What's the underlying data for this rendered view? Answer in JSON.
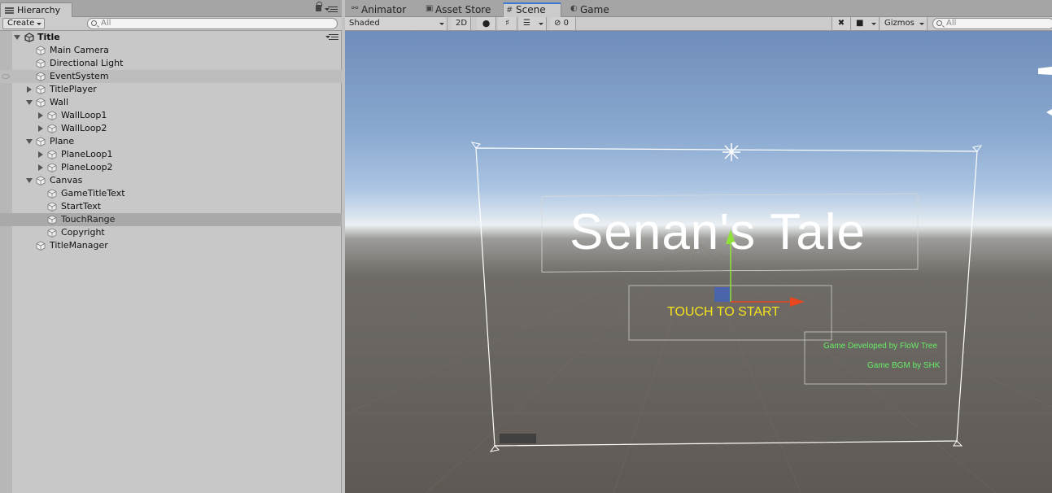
{
  "hierarchy": {
    "tab_label": "Hierarchy",
    "create_label": "Create",
    "search_placeholder": "All",
    "scene_name": "Title",
    "items": [
      {
        "label": "Main Camera",
        "depth": 1,
        "expand": "none",
        "state": ""
      },
      {
        "label": "Directional Light",
        "depth": 1,
        "expand": "none",
        "state": ""
      },
      {
        "label": "EventSystem",
        "depth": 1,
        "expand": "none",
        "state": "hover"
      },
      {
        "label": "TitlePlayer",
        "depth": 1,
        "expand": "collapsed",
        "state": ""
      },
      {
        "label": "Wall",
        "depth": 1,
        "expand": "expanded",
        "state": ""
      },
      {
        "label": "WallLoop1",
        "depth": 2,
        "expand": "collapsed",
        "state": ""
      },
      {
        "label": "WallLoop2",
        "depth": 2,
        "expand": "collapsed",
        "state": ""
      },
      {
        "label": "Plane",
        "depth": 1,
        "expand": "expanded",
        "state": ""
      },
      {
        "label": "PlaneLoop1",
        "depth": 2,
        "expand": "collapsed",
        "state": ""
      },
      {
        "label": "PlaneLoop2",
        "depth": 2,
        "expand": "collapsed",
        "state": ""
      },
      {
        "label": "Canvas",
        "depth": 1,
        "expand": "expanded",
        "state": ""
      },
      {
        "label": "GameTitleText",
        "depth": 2,
        "expand": "none",
        "state": ""
      },
      {
        "label": "StartText",
        "depth": 2,
        "expand": "none",
        "state": ""
      },
      {
        "label": "TouchRange",
        "depth": 2,
        "expand": "none",
        "state": "selected"
      },
      {
        "label": "Copyright",
        "depth": 2,
        "expand": "none",
        "state": ""
      },
      {
        "label": "TitleManager",
        "depth": 1,
        "expand": "none",
        "state": ""
      }
    ]
  },
  "tabs": {
    "animator": "Animator",
    "asset_store": "Asset Store",
    "scene": "Scene",
    "game": "Game"
  },
  "scene_toolbar": {
    "shading_mode": "Shaded",
    "mode_2d": "2D",
    "hidden_count": "0",
    "gizmos": "Gizmos",
    "search_placeholder": "All"
  },
  "scene_view": {
    "game_title": "Senan's Tale",
    "start_text": "TOUCH TO START",
    "copyright_line1": "Game Developed by FloW Tree",
    "copyright_line2": "Game BGM by SHK",
    "colors": {
      "title": "#ffffff",
      "start": "#f4e21c",
      "copyright": "#66ee66",
      "gizmo_x": "#e8471f",
      "gizmo_y": "#8fe23a",
      "gizmo_z": "#3c62c8"
    }
  }
}
